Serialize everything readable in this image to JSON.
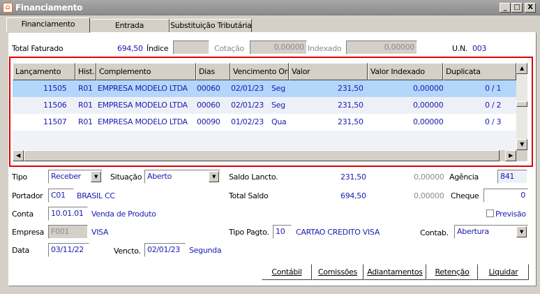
{
  "window": {
    "title": "Financiamento",
    "controls": [
      "_",
      "□",
      "X"
    ]
  },
  "tabs": [
    {
      "label": "Financiamento"
    },
    {
      "label": "Entrada"
    },
    {
      "label": "Substituição Tributária"
    }
  ],
  "summary": {
    "total_faturado_label": "Total Faturado",
    "total_faturado": "694,50",
    "indice_label": "Índice",
    "indice": "",
    "cotacao_label": "Cotação",
    "cotacao": "0,00000",
    "indexado_label": "Indexado",
    "indexado": "0,00000",
    "un_label": "U.N.",
    "un": "003"
  },
  "grid": {
    "columns": [
      "Lançamento",
      "Hist.",
      "Complemento",
      "Dias",
      "Vencimento Orig.",
      "Valor",
      "Valor Indexado",
      "Duplicata"
    ],
    "rows": [
      {
        "lanc": "11505",
        "hist": "R01",
        "comp": "EMPRESA MODELO LTDA",
        "dias": "00060",
        "venc": "02/01/23",
        "dia": "Seg",
        "valor": "231,50",
        "vidx": "0,00000",
        "dup": "0 / 1"
      },
      {
        "lanc": "11506",
        "hist": "R01",
        "comp": "EMPRESA MODELO LTDA",
        "dias": "00060",
        "venc": "02/01/23",
        "dia": "Seg",
        "valor": "231,50",
        "vidx": "0,00000",
        "dup": "0 / 2"
      },
      {
        "lanc": "11507",
        "hist": "R01",
        "comp": "EMPRESA MODELO LTDA",
        "dias": "00090",
        "venc": "01/02/23",
        "dia": "Qua",
        "valor": "231,50",
        "vidx": "0,00000",
        "dup": "0 / 3"
      }
    ]
  },
  "form": {
    "tipo_label": "Tipo",
    "tipo": "Receber",
    "situacao_label": "Situação",
    "situacao": "Aberto",
    "saldo_lancto_label": "Saldo Lancto.",
    "saldo_lancto": "231,50",
    "saldo_lancto_idx": "0,00000",
    "agencia_label": "Agência",
    "agencia": "841",
    "portador_label": "Portador",
    "portador": "C01",
    "portador_nome": "BRASIL CC",
    "total_saldo_label": "Total Saldo",
    "total_saldo": "694,50",
    "total_saldo_idx": "0,00000",
    "cheque_label": "Cheque",
    "cheque": "0",
    "conta_label": "Conta",
    "conta": "10.01.01",
    "conta_nome": "Venda de Produto",
    "previsao_label": "Previsão",
    "empresa_label": "Empresa",
    "empresa": "F001",
    "empresa_nome": "VISA",
    "tipo_pagto_label": "Tipo Pagto.",
    "tipo_pagto": "10",
    "tipo_pagto_nome": "CARTAO CREDITO VISA",
    "contab_label": "Contab.",
    "contab": "Abertura",
    "data_label": "Data",
    "data": "03/11/22",
    "vencto_label": "Vencto.",
    "vencto": "02/01/23",
    "vencto_dia": "Segunda"
  },
  "buttons": [
    "Contábil",
    "Comissões",
    "Adiantamentos",
    "Retenção",
    "Liquidar"
  ]
}
